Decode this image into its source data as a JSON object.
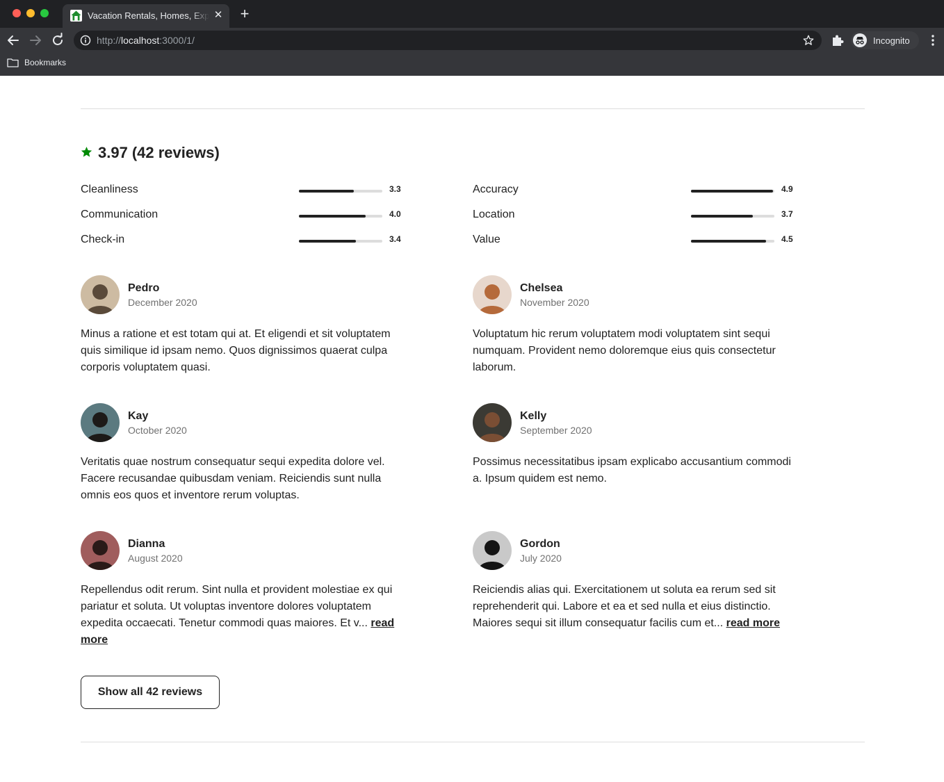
{
  "browser": {
    "tab_title": "Vacation Rentals, Homes, Experiences",
    "url_prefix": "http://",
    "url_host": "localhost",
    "url_suffix": ":3000/1/",
    "incognito_label": "Incognito",
    "bookmarks_label": "Bookmarks",
    "close_glyph": "✕",
    "new_tab_glyph": "+"
  },
  "summary": {
    "rating": "3.97",
    "reviews_text": "(42 reviews)",
    "star_color": "#008a05"
  },
  "categories": [
    {
      "label": "Cleanliness",
      "value": "3.3",
      "score": 3.3
    },
    {
      "label": "Accuracy",
      "value": "4.9",
      "score": 4.9
    },
    {
      "label": "Communication",
      "value": "4.0",
      "score": 4.0
    },
    {
      "label": "Location",
      "value": "3.7",
      "score": 3.7
    },
    {
      "label": "Check-in",
      "value": "3.4",
      "score": 3.4
    },
    {
      "label": "Value",
      "value": "4.5",
      "score": 4.5
    }
  ],
  "reviews": [
    {
      "name": "Pedro",
      "date": "December 2020",
      "text": "Minus a ratione et est totam qui at. Et eligendi et sit voluptatem quis similique id ipsam nemo. Quos dignissimos quaerat culpa corporis voluptatem quasi.",
      "read_more": "",
      "avatar_colors": [
        "#cdbba2",
        "#5a4a3a"
      ]
    },
    {
      "name": "Chelsea",
      "date": "November 2020",
      "text": "Voluptatum hic rerum voluptatem modi voluptatem sint sequi numquam. Provident nemo doloremque eius quis consectetur laborum.",
      "read_more": "",
      "avatar_colors": [
        "#e7d7cc",
        "#b56a3b"
      ]
    },
    {
      "name": "Kay",
      "date": "October 2020",
      "text": "Veritatis quae nostrum consequatur sequi expedita dolore vel. Facere recusandae quibusdam veniam. Reiciendis sunt nulla omnis eos quos et inventore rerum voluptas.",
      "read_more": "",
      "avatar_colors": [
        "#5b7a80",
        "#1d1a18"
      ]
    },
    {
      "name": "Kelly",
      "date": "September 2020",
      "text": "Possimus necessitatibus ipsam explicabo accusantium commodi a. Ipsum quidem est nemo.",
      "read_more": "",
      "avatar_colors": [
        "#3b3a34",
        "#7a4e34"
      ]
    },
    {
      "name": "Dianna",
      "date": "August 2020",
      "text": "Repellendus odit rerum. Sint nulla et provident molestiae ex qui pariatur et soluta. Ut voluptas inventore dolores voluptatem expedita occaecati. Tenetur commodi quas maiores. Et v...",
      "read_more": "read more",
      "avatar_colors": [
        "#a05d5d",
        "#2a1a18"
      ]
    },
    {
      "name": "Gordon",
      "date": "July 2020",
      "text": "Reiciendis alias qui. Exercitationem ut soluta ea rerum sed sit reprehenderit qui. Labore et ea et sed nulla et eius distinctio. Maiores sequi sit illum consequatur facilis cum et...",
      "read_more": "read more",
      "avatar_colors": [
        "#c9c9c9",
        "#141414"
      ]
    }
  ],
  "show_all_label": "Show all 42 reviews"
}
